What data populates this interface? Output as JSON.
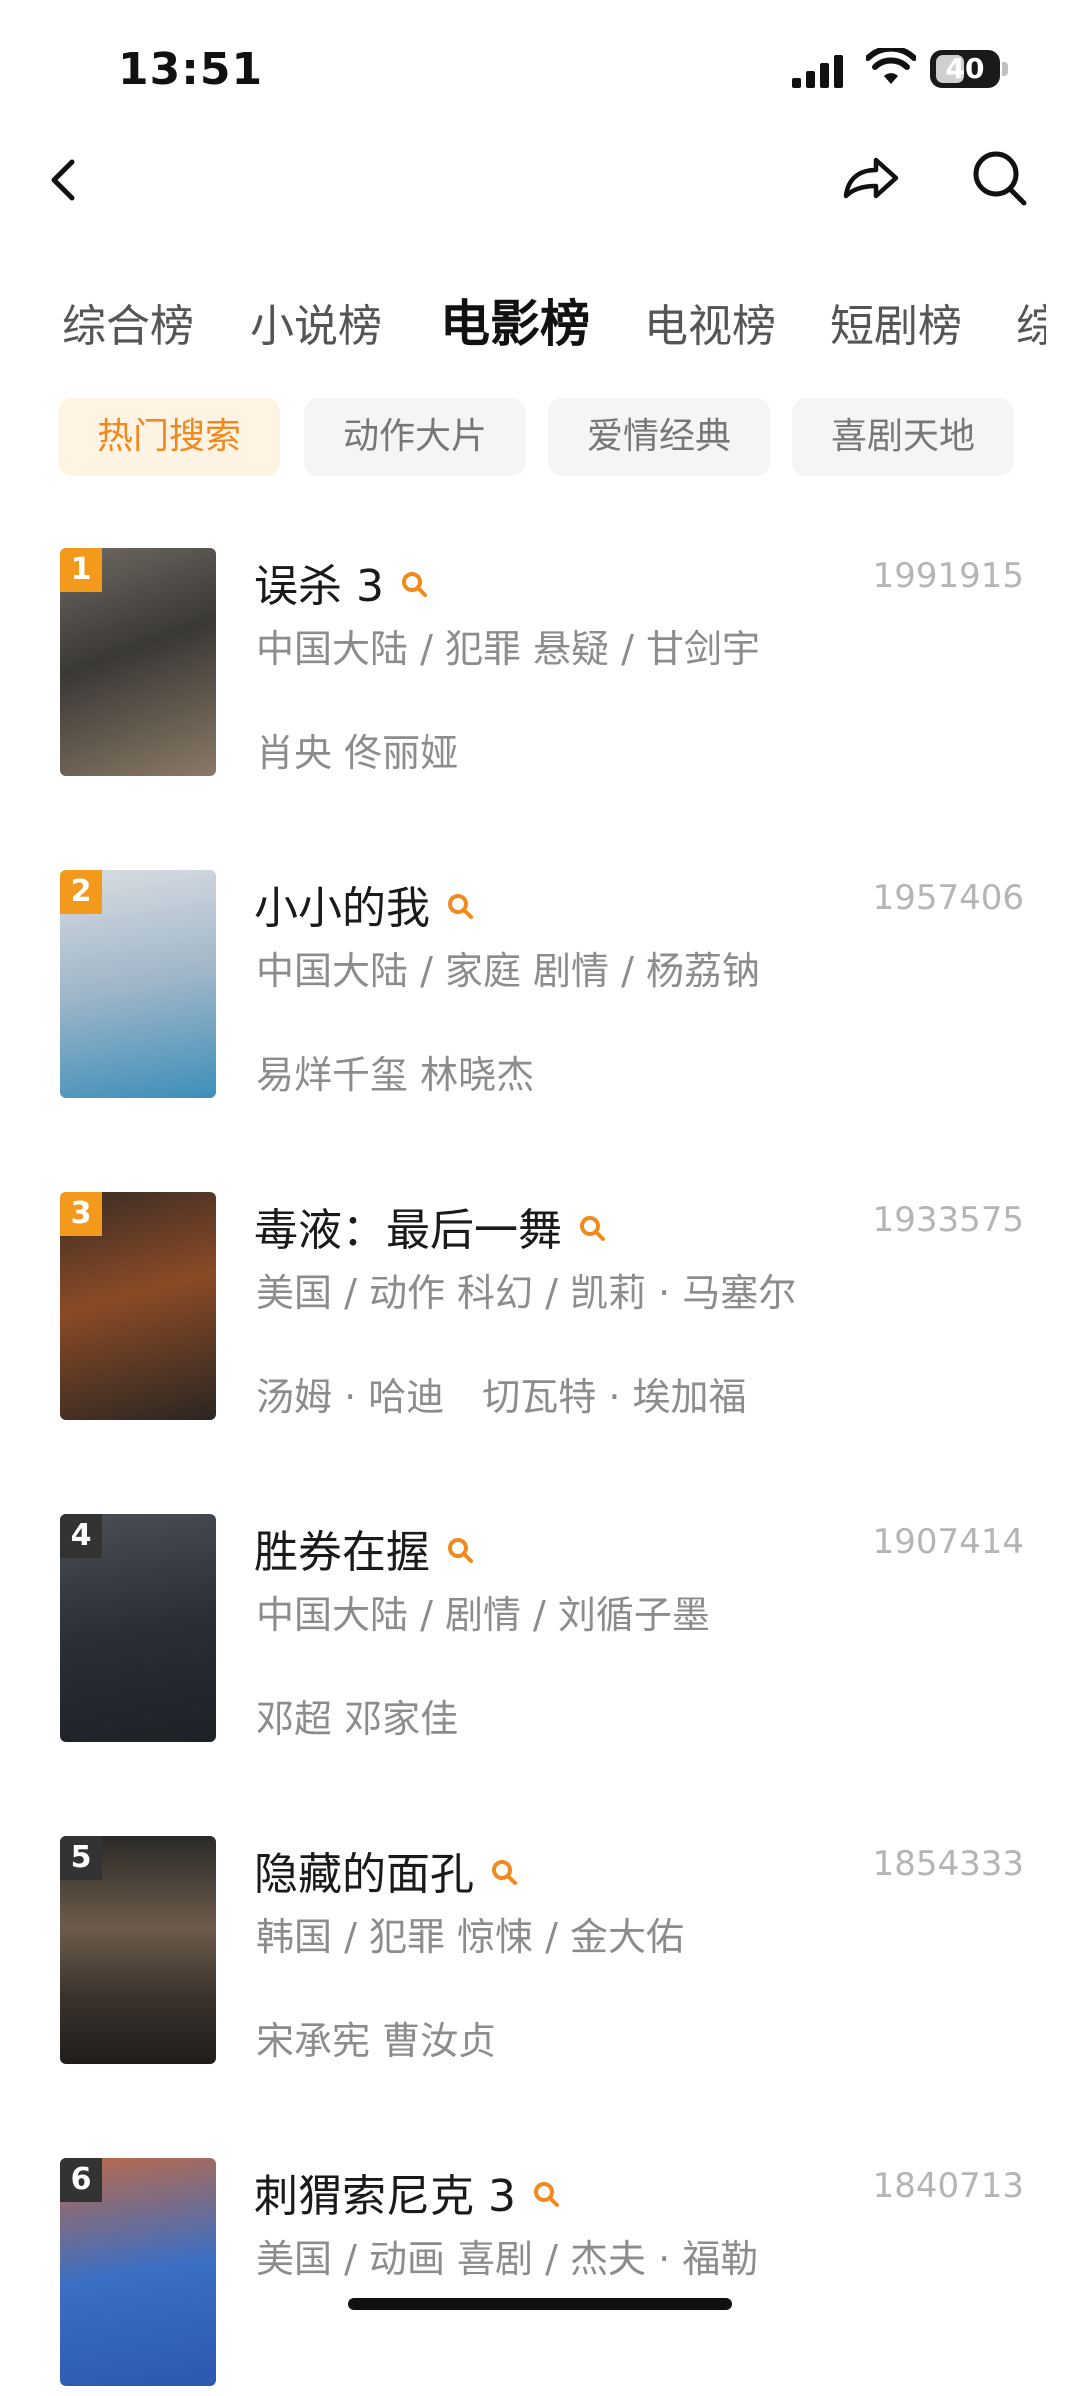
{
  "status": {
    "time": "13:51",
    "battery": "40"
  },
  "tabs": [
    "综合榜",
    "小说榜",
    "电影榜",
    "电视榜",
    "短剧榜",
    "综"
  ],
  "chips": [
    "热门搜索",
    "动作大片",
    "爱情经典",
    "喜剧天地"
  ],
  "movies": [
    {
      "rank": "1",
      "title": "误杀 3",
      "count": "1991915",
      "info": "中国大陆 / 犯罪 悬疑 / 甘剑宇",
      "cast": "肖央 佟丽娅"
    },
    {
      "rank": "2",
      "title": "小小的我",
      "count": "1957406",
      "info": "中国大陆 / 家庭 剧情 / 杨荔钠",
      "cast": "易烊千玺 林晓杰"
    },
    {
      "rank": "3",
      "title": "毒液：最后一舞",
      "count": "1933575",
      "info": "美国 / 动作 科幻 / 凯莉 · 马塞尔",
      "cast": "汤姆 · 哈迪　切瓦特 · 埃加福"
    },
    {
      "rank": "4",
      "title": "胜券在握",
      "count": "1907414",
      "info": "中国大陆 / 剧情 / 刘循子墨",
      "cast": "邓超 邓家佳"
    },
    {
      "rank": "5",
      "title": "隐藏的面孔",
      "count": "1854333",
      "info": "韩国 / 犯罪 惊悚 / 金大佑",
      "cast": "宋承宪 曹汝贞"
    },
    {
      "rank": "6",
      "title": "刺猬索尼克 3",
      "count": "1840713",
      "info": "美国 / 动画 喜剧 / 杰夫 · 福勒",
      "cast": ""
    }
  ],
  "colors": {
    "accent": "#f08a1e",
    "rank_top": "#f39a1c",
    "rank_other": "#333333"
  }
}
